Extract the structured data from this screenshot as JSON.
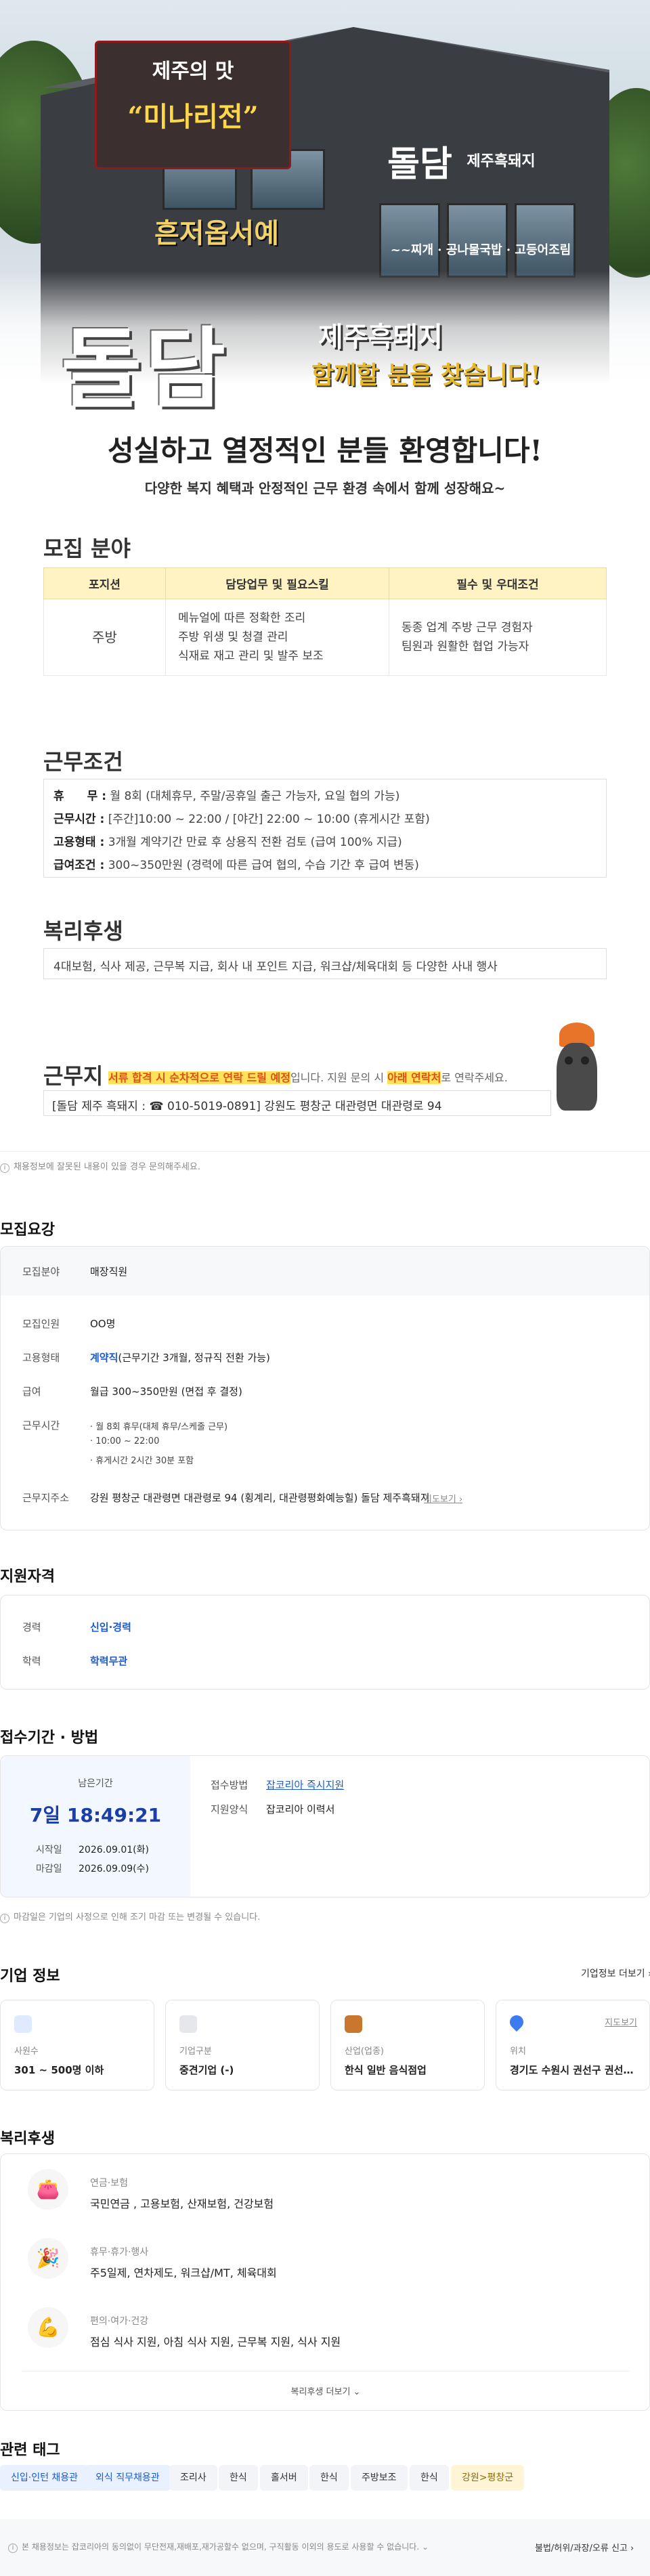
{
  "hero": {
    "sign_top": "제주의 맛",
    "sign_main": "“미나리전”",
    "sign_bottom": "흔저옵서예",
    "side_name": "돌담",
    "side_sub": "제주흑돼지",
    "menu_strip": "~~찌개 · 공나물국밥 · 고등어조림",
    "brand": "돌담",
    "brand_sub": "제주흑돼지",
    "brand_slogan": "함께할 분을 찾습니다!"
  },
  "intro": {
    "headline": "성실하고 열정적인 분들 환영합니다!",
    "subline": "다양한 복지 혜택과 안정적인 근무 환경 속에서 함께 성장해요~"
  },
  "recruit_field": {
    "title": "모집 분야",
    "headers": [
      "포지션",
      "담당업무 및 필요스킬",
      "필수 및 우대조건"
    ],
    "position": "주방",
    "duties": [
      "메뉴얼에 따른 정확한 조리",
      "주방 위생 및 청결 관리",
      "식재료 재고 관리 및 발주 보조"
    ],
    "requirements": [
      "동종 업계 주방 근무 경험자",
      "팀원과 원활한 협업 가능자"
    ]
  },
  "work_conditions": {
    "title": "근무조건",
    "rows": [
      {
        "label": "휴　　무 :",
        "value": "월 8회 (대체휴무, 주말/공휴일 출근 가능자, 요일 협의 가능)"
      },
      {
        "label": "근무시간 :",
        "value": "[주간]10:00 ~ 22:00 / [야간] 22:00 ~ 10:00 (휴게시간 포함)"
      },
      {
        "label": "고용형태 :",
        "value": "3개월 계약기간 만료 후 상용직 전환 검토 (급여 100% 지급)"
      },
      {
        "label": "급여조건 :",
        "value": "300~350만원 (경력에 따른 급여 협의, 수습 기간 후 급여 변동)"
      }
    ]
  },
  "welfare_banner": {
    "title": "복리후생",
    "text": "4대보험, 식사 제공, 근무복 지급, 회사 내 포인트 지급, 워크샵/체육대회 등 다양한 사내 행사"
  },
  "workplace": {
    "title": "근무지",
    "note_hl1": "서류 합격 시 순차적으로 연락 드릴 예정",
    "note_mid": "입니다. 지원 문의 시 ",
    "note_hl2": "아래 연락처",
    "note_end": "로 연락주세요.",
    "address_line": "[돌담 제주 흑돼지 : ☎ 010-5019-0891] 강원도 평창군 대관령면 대관령로 94"
  },
  "notice_top": "채용정보에 잘못된 내용이 있을 경우 문의해주세요.",
  "summary": {
    "title": "모집요강",
    "field_label": "모집분야",
    "field_value": "매장직원",
    "count_label": "모집인원",
    "count_value": "OO명",
    "type_label": "고용형태",
    "type_value_hl": "계약직",
    "type_value_rest": "(근무기간 3개월, 정규직 전환 가능)",
    "pay_label": "급여",
    "pay_value": "월급 300~350만원 (면접 후 결정)",
    "time_label": "근무시간",
    "time_items": [
      "월 8회 휴무(대체 휴무/스케줄 근무)",
      "10:00 ~ 22:00",
      "휴게시간 2시간 30분 포함"
    ],
    "loc_label": "근무지주소",
    "loc_value": "강원 평창군 대관령면 대관령로 94 (횡계리, 대관령평화예능힐) 돌담 제주흑돼지",
    "map_link": "지도보기"
  },
  "qualification": {
    "title": "지원자격",
    "career_label": "경력",
    "career_value": "신입·경력",
    "edu_label": "학력",
    "edu_value": "학력무관"
  },
  "apply": {
    "title": "접수기간 · 방법",
    "remain_label": "남은기간",
    "remain_value": "7일 18:49:21",
    "start_label": "시작일",
    "start_value": "2026.09.01(화)",
    "end_label": "마감일",
    "end_value": "2026.09.09(수)",
    "method_label": "접수방법",
    "method_value": "잡코리아 즉시지원",
    "form_label": "지원양식",
    "form_value": "잡코리아 이력서",
    "note": "마감일은 기업의 사정으로 인해 조기 마감 또는 변경될 수 있습니다."
  },
  "company": {
    "title": "기업 정보",
    "more": "기업정보 더보기",
    "cards": [
      {
        "label": "사원수",
        "value": "301 ~ 500명 이하"
      },
      {
        "label": "기업구분",
        "value": "중견기업 (-)"
      },
      {
        "label": "산업(업종)",
        "value": "한식 일반 음식점업"
      },
      {
        "label": "위치",
        "value": "경기도 수원시 권선구 권선로 72..."
      }
    ],
    "map_link": "지도보기"
  },
  "benefits": {
    "title": "복리후생",
    "items": [
      {
        "title": "연금·보험",
        "value": "국민연금 , 고용보험, 산재보험, 건강보험"
      },
      {
        "title": "휴무·휴가·행사",
        "value": "주5일제, 연차제도, 워크샵/MT, 체육대회"
      },
      {
        "title": "편의·여가·건강",
        "value": "점심 식사 지원, 아침 식사 지원, 근무복 지원, 식사 지원"
      }
    ],
    "more": "복리후생 더보기"
  },
  "tags": {
    "title": "관련 태그",
    "items": [
      "신입·인턴 채용관",
      "외식 직무채용관",
      "조리사",
      "한식",
      "홀서버",
      "한식",
      "주방보조",
      "한식",
      "강원>평창군"
    ]
  },
  "footer": {
    "notice": "본 채용정보는 잡코리아의 동의없이 무단전재,재배포,재가공할수 없으며, 구직활동 이외의 용도로 사용할 수 없습니다.",
    "report": "불법/허위/과장/오류 신고"
  }
}
